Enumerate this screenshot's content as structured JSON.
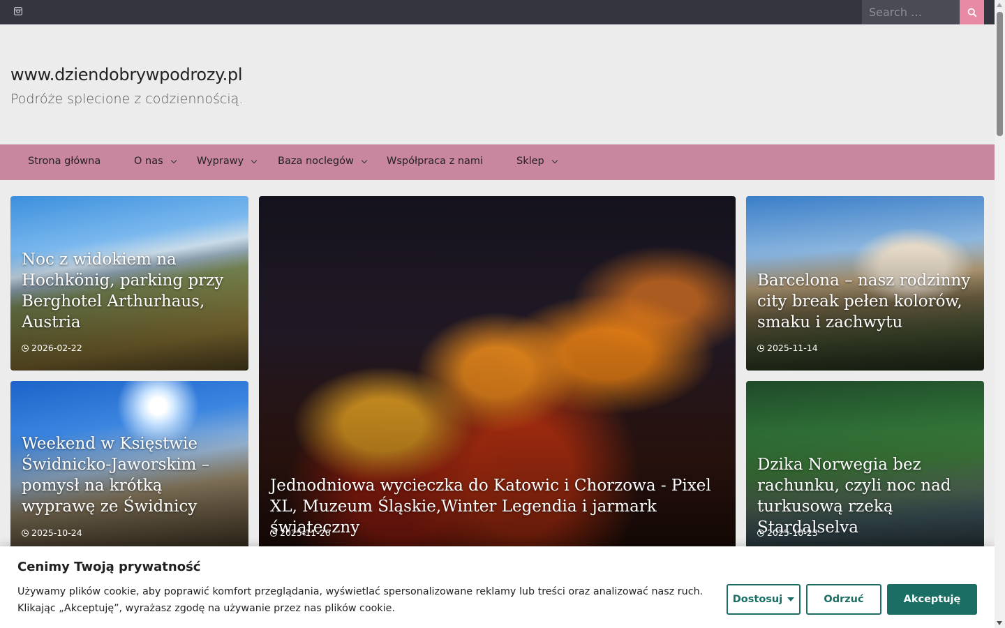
{
  "topbar": {
    "search_placeholder": "Search …",
    "search_icon": "magnifier-icon",
    "social_icon": "instagram-icon"
  },
  "header": {
    "site_title": "www.dziendobrywpodrozy.pl",
    "tagline": "Podróże splecione z codziennością."
  },
  "nav": {
    "items": [
      {
        "label": "Strona główna",
        "has_dropdown": false
      },
      {
        "label": "O nas",
        "has_dropdown": true
      },
      {
        "label": "Wyprawy",
        "has_dropdown": true
      },
      {
        "label": "Baza noclegów",
        "has_dropdown": true
      },
      {
        "label": "Współpraca z nami",
        "has_dropdown": false
      },
      {
        "label": "Sklep",
        "has_dropdown": true
      }
    ]
  },
  "posts": [
    {
      "title": "Noc z widokiem na Hochkönig, parking przy Berghotel Arthurhaus, Austria",
      "date": "2026-02-22"
    },
    {
      "title": "Weekend w Księstwie Świdnicko-Jaworskim – pomysł na krótką wyprawę ze Świdnicy",
      "date": "2025-10-24"
    },
    {
      "title": "Jednodniowa wycieczka do Katowic i Chorzowa - Pixel XL, Muzeum Śląskie,Winter Legendia i jarmark świąteczny",
      "date": "2025-11-26"
    },
    {
      "title": "Barcelona – nasz rodzinny city break pełen kolorów, smaku i zachwytu",
      "date": "2025-11-14"
    },
    {
      "title": "Dzika Norwegia bez rachunku, czyli noc nad turkusową rzeką Stardalselva",
      "date": "2025-10-23"
    }
  ],
  "cookie": {
    "title": "Cenimy Twoją prywatność",
    "text": "Używamy plików cookie, aby poprawić komfort przeglądania, wyświetlać spersonalizowane reklamy lub treści oraz analizować nasz ruch. Klikając „Akceptuję”, wyrażasz zgodę na używanie przez nas plików cookie.",
    "customize_label": "Dostosuj",
    "reject_label": "Odrzuć",
    "accept_label": "Akceptuję"
  },
  "colors": {
    "topbar_bg": "#34353f",
    "nav_bg": "#c8869f",
    "search_button_bg": "#e88aa4",
    "cookie_accent": "#1b6e64"
  }
}
